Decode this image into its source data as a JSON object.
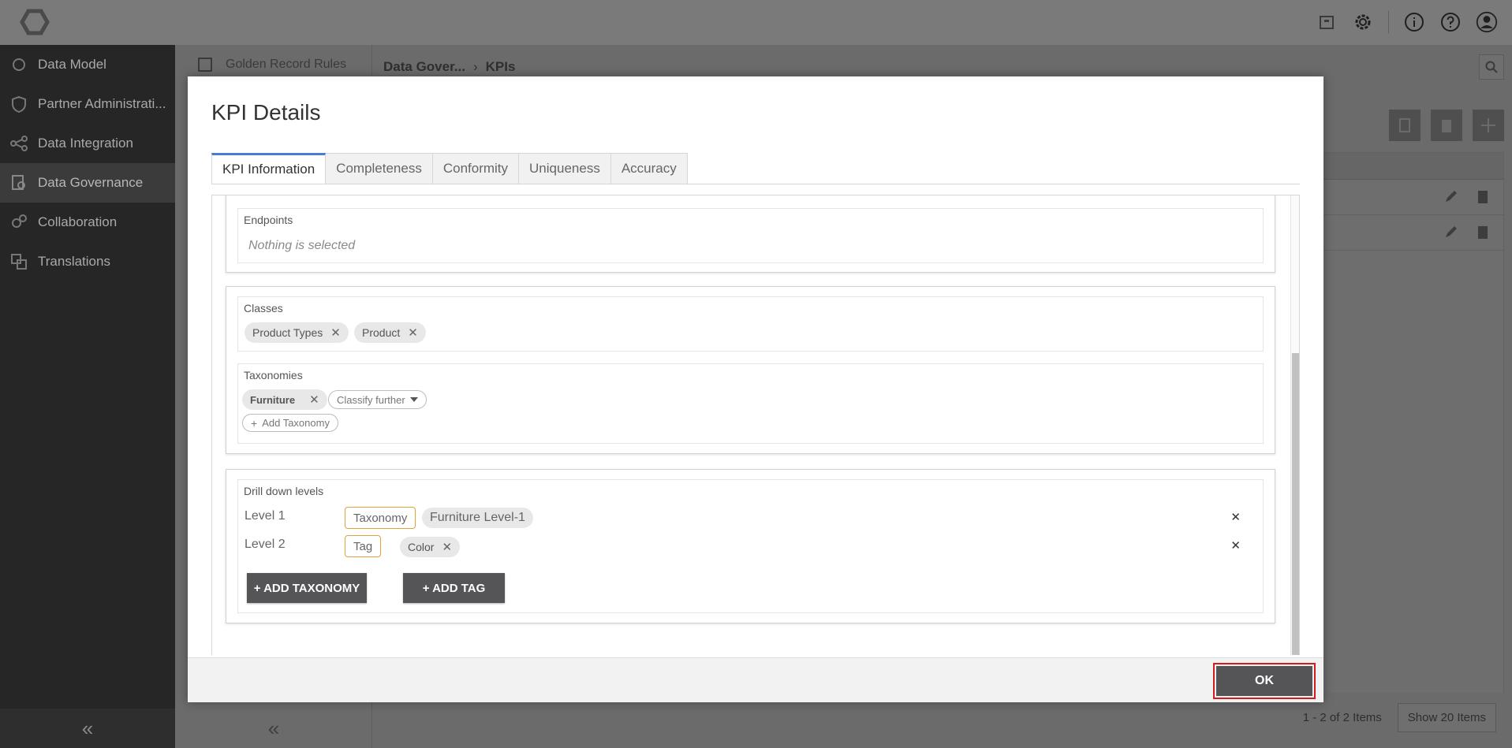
{
  "sidebar": {
    "items": [
      {
        "label": "Data Model",
        "icon": "data-model-icon"
      },
      {
        "label": "Partner Administrati...",
        "icon": "partner-shield-icon"
      },
      {
        "label": "Data Integration",
        "icon": "integration-icon"
      },
      {
        "label": "Data Governance",
        "icon": "governance-icon"
      },
      {
        "label": "Collaboration",
        "icon": "collaboration-icon"
      },
      {
        "label": "Translations",
        "icon": "translations-icon"
      }
    ],
    "collapse_glyph": "«"
  },
  "subnav": {
    "items": [
      {
        "label": "Golden Record Rules"
      }
    ],
    "collapse_glyph": "«"
  },
  "content": {
    "breadcrumb_parent": "Data Gover...",
    "breadcrumb_sep": "›",
    "breadcrumb_current": "KPIs",
    "pager_text": "1 - 2 of 2 Items",
    "show_items_label": "Show 20 Items"
  },
  "modal": {
    "title": "KPI Details",
    "tabs": [
      "KPI Information",
      "Completeness",
      "Conformity",
      "Uniqueness",
      "Accuracy"
    ],
    "endpoints": {
      "label": "Endpoints",
      "placeholder": "Nothing is selected"
    },
    "classes": {
      "label": "Classes",
      "chips": [
        "Product Types",
        "Product"
      ]
    },
    "taxonomies": {
      "label": "Taxonomies",
      "chip": "Furniture",
      "classify_label": "Classify further",
      "add_label": "Add Taxonomy"
    },
    "drill": {
      "label": "Drill down levels",
      "levels": [
        {
          "name": "Level 1",
          "type": "Taxonomy",
          "value": "Furniture Level-1"
        },
        {
          "name": "Level 2",
          "type": "Tag",
          "value": "Color"
        }
      ],
      "add_taxonomy": "+ ADD TAXONOMY",
      "add_tag": "+ ADD TAG"
    },
    "ok_label": "OK"
  },
  "colors": {
    "tab_accent": "#4a7bd8",
    "type_tag_border": "#e0a23a",
    "ok_highlight": "#d41c1c",
    "dark_button": "#555557"
  }
}
